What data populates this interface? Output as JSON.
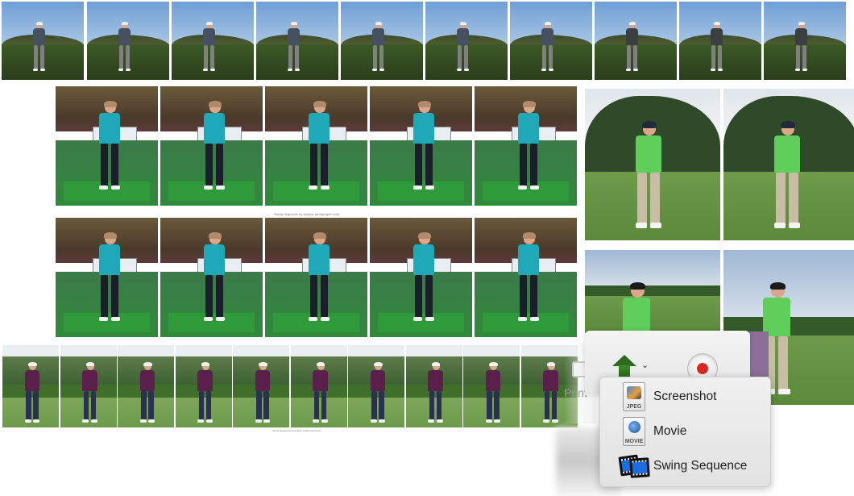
{
  "collage": {
    "strip1": {
      "frame_count": 10,
      "subject": "golfer outdoor sunset"
    },
    "strip2": {
      "rows": 2,
      "frames_per_row": 5,
      "caption": "Swing Sequence by Analyzr (analyzrgolf.com)",
      "subject": "girl indoor range"
    },
    "strip3": {
      "frame_count": 10,
      "subject": "golfer purple shirt",
      "caption": "Swing Sequence by Analyzr (analyzrgolf.com)"
    },
    "right_photos": {
      "count": 4,
      "subject": "golfer green shirt"
    }
  },
  "toolbar": {
    "print_label": "Print",
    "share_icon": "share-arrow-icon",
    "chevron": "⌄",
    "record_icon": "record-icon"
  },
  "menu": {
    "items": [
      {
        "label": "Screenshot",
        "icon": "jpeg-file-icon",
        "icon_tag": "JPEG"
      },
      {
        "label": "Movie",
        "icon": "movie-file-icon",
        "icon_tag": "MOVIE"
      },
      {
        "label": "Swing Sequence",
        "icon": "film-strip-icon"
      }
    ]
  },
  "colors": {
    "share_arrow": "#2e6b1f",
    "record_dot": "#d92a22",
    "menu_bg": "#ebebeb",
    "purple_accent": "#8c6f98"
  }
}
